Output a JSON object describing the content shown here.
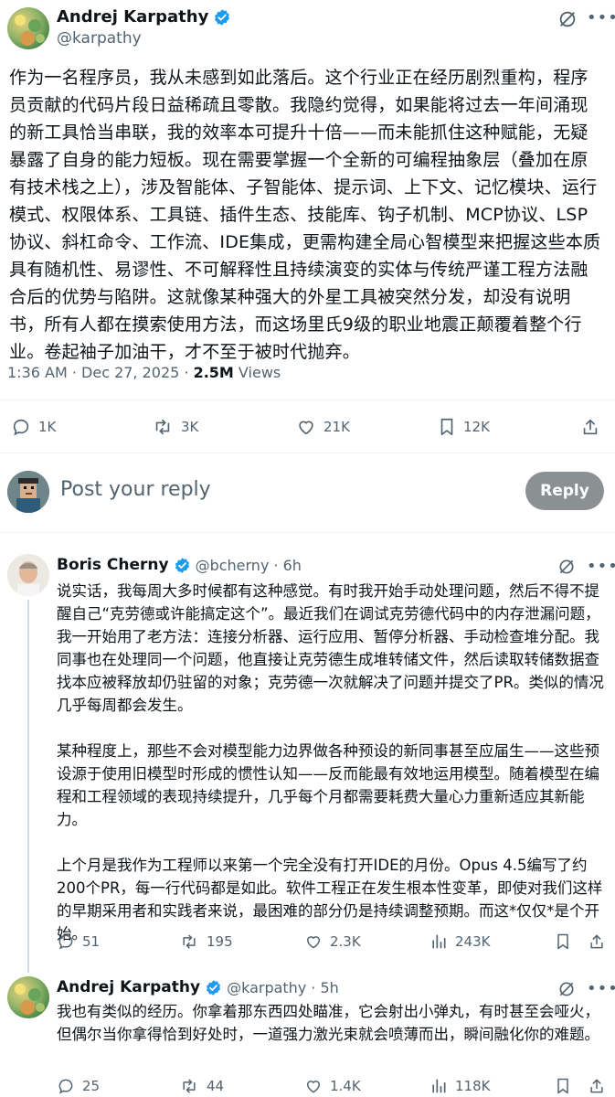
{
  "main_tweet": {
    "author_name": "Andrej Karpathy",
    "author_handle": "@karpathy",
    "text": "作为一名程序员，我从未感到如此落后。这个行业正在经历剧烈重构，程序员贡献的代码片段日益稀疏且零散。我隐约觉得，如果能将过去一年间涌现的新工具恰当串联，我的效率本可提升十倍——而未能抓住这种赋能，无疑暴露了自身的能力短板。现在需要掌握一个全新的可编程抽象层（叠加在原有技术栈之上），涉及智能体、子智能体、提示词、上下文、记忆模块、运行模式、权限体系、工具链、插件生态、技能库、钩子机制、MCP协议、LSP协议、斜杠命令、工作流、IDE集成，更需构建全局心智模型来把握这些本质具有随机性、易谬性、不可解释性且持续演变的实体与传统严谨工程方法融合后的优势与陷阱。这就像某种强大的外星工具被突然分发，却没有说明书，所有人都在摸索使用方法，而这场里氏9级的职业地震正颠覆着整个行业。卷起袖子加油干，才不至于被时代抛弃。",
    "timestamp": "1:36 AM · Dec 27, 2025 · ",
    "views_count": "2.5M",
    "views_label": " Views",
    "stats": {
      "replies": "1K",
      "reposts": "3K",
      "likes": "21K",
      "bookmarks": "12K"
    }
  },
  "compose": {
    "placeholder": "Post your reply",
    "button_label": "Reply"
  },
  "replies": [
    {
      "author_name": "Boris Cherny",
      "author_handle": "@bcherny",
      "time": " · 6h",
      "paragraphs": [
        "说实话，我每周大多时候都有这种感觉。有时我开始手动处理问题，然后不得不提醒自己“克劳德或许能搞定这个”。最近我们在调试克劳德代码中的内存泄漏问题，我一开始用了老方法：连接分析器、运行应用、暂停分析器、手动检查堆分配。我同事也在处理同一个问题，他直接让克劳德生成堆转储文件，然后读取转储数据查找本应被释放却仍驻留的对象；克劳德一次就解决了问题并提交了PR。类似的情况几乎每周都会发生。",
        "某种程度上，那些不会对模型能力边界做各种预设的新同事甚至应届生——这些预设源于使用旧模型时形成的惯性认知——反而能最有效地运用模型。随着模型在编程和工程领域的表现持续提升，几乎每个月都需要耗费大量心力重新适应其新能力。",
        "上个月是我作为工程师以来第一个完全没有打开IDE的月份。Opus 4.5编写了约200个PR，每一行代码都是如此。软件工程正在发生根本性变革，即使对我们这样的早期采用者和实践者来说，最困难的部分仍是持续调整预期。而这*仅仅*是个开始。"
      ],
      "stats": {
        "replies": "51",
        "reposts": "195",
        "likes": "2.3K",
        "views": "243K"
      }
    },
    {
      "author_name": "Andrej Karpathy",
      "author_handle": "@karpathy",
      "time": " · 5h",
      "paragraphs": [
        "我也有类似的经历。你拿着那东西四处瞄准，它会射出小弹丸，有时甚至会哑火，但偶尔当你拿得恰到好处时，一道强力激光束就会喷薄而出，瞬间融化你的难题。"
      ],
      "stats": {
        "replies": "25",
        "reposts": "44",
        "likes": "1.4K",
        "views": "118K"
      }
    }
  ],
  "colors": {
    "verified": "#1d9bf0",
    "secondary": "#536471",
    "reply_button": "#8b9093"
  },
  "icons": [
    "grok-icon",
    "more-icon",
    "reply-icon",
    "repost-icon",
    "like-icon",
    "bookmark-icon",
    "share-icon",
    "views-icon",
    "verified-badge-icon"
  ]
}
